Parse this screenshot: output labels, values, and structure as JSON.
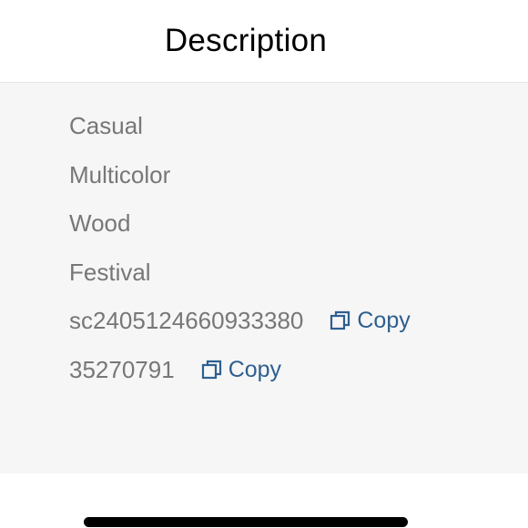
{
  "header": {
    "title": "Description"
  },
  "details": [
    {
      "value": "Casual"
    },
    {
      "value": "Multicolor"
    },
    {
      "value": "Wood"
    },
    {
      "value": "Festival"
    },
    {
      "value": "sc2405124660933380",
      "copy_label": "Copy"
    },
    {
      "value": "35270791",
      "copy_label": "Copy"
    }
  ],
  "icons": {
    "copy": "copy-icon"
  },
  "colors": {
    "link": "#2d5f8f",
    "value_text": "#777777",
    "panel_bg": "#f6f6f6"
  }
}
